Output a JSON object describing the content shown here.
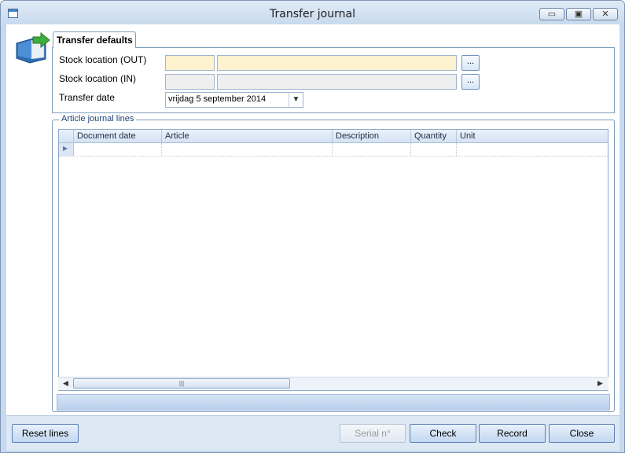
{
  "window": {
    "title": "Transfer journal",
    "controls": {
      "minimize": "▭",
      "maximize": "▣",
      "close": "✕"
    }
  },
  "tabs": [
    {
      "label": "Transfer defaults"
    }
  ],
  "defaults": {
    "stock_out_label": "Stock location (OUT)",
    "stock_out_code": "",
    "stock_out_name": "",
    "stock_in_label": "Stock location (IN)",
    "stock_in_code": "",
    "stock_in_name": "",
    "browse_label": "...",
    "transfer_date_label": "Transfer date",
    "transfer_date_value": "vrijdag 5 september 2014"
  },
  "journal": {
    "group_title": "Article journal lines",
    "columns": [
      "Document date",
      "Article",
      "Description",
      "Quantity",
      "Unit"
    ],
    "rows": []
  },
  "buttons": {
    "reset_lines": "Reset lines",
    "serial": "Serial n°",
    "check": "Check",
    "record": "Record",
    "close": "Close"
  },
  "colors": {
    "window_frame": "#c7d9ef",
    "required_field": "#fdf1cf",
    "disabled_field": "#efefef",
    "accent": "#5b7eb3"
  }
}
